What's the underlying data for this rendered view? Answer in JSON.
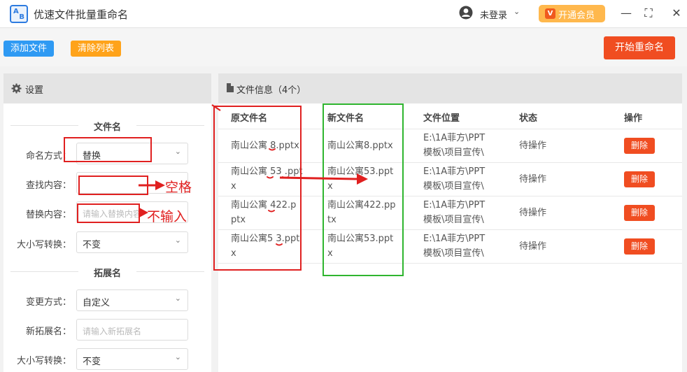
{
  "app": {
    "logo_a": "A",
    "logo_b": "B",
    "title": "优速文件批量重命名"
  },
  "header": {
    "user_label": "未登录",
    "user_caret": "⌄",
    "vip_icon": "V",
    "vip_label": "开通会员",
    "minimize": "—",
    "maximize": "⛶",
    "close": "✕"
  },
  "toolbar": {
    "add_label": "添加文件",
    "clear_label": "清除列表",
    "start_label": "开始重命名"
  },
  "settings": {
    "title": "设置",
    "filename_section": "文件名",
    "mode_label": "命名方式：",
    "mode_value": "替换",
    "find_label": "查找内容：",
    "find_value": "",
    "replace_label": "替换内容：",
    "replace_placeholder": "请输入替换内容",
    "case_label": "大小写转换：",
    "case_value": "不变",
    "ext_section": "拓展名",
    "ext_mode_label": "变更方式：",
    "ext_mode_value": "自定义",
    "new_ext_label": "新拓展名：",
    "new_ext_placeholder": "请输入新拓展名",
    "ext_case_label": "大小写转换：",
    "ext_case_value": "不变",
    "chevron": "⌄"
  },
  "files": {
    "title": "文件信息（4个）",
    "columns": [
      "原文件名",
      "新文件名",
      "文件位置",
      "状态",
      "操作"
    ],
    "rows": [
      {
        "orig_1": "南山公寓 8.pptx",
        "orig_2": "",
        "new_1": "南山公寓8.pptx",
        "new_2": "",
        "loc_1": "E:\\1A菲方\\PPT",
        "loc_2": "模板\\项目宣传\\",
        "status": "待操作",
        "action": "删除"
      },
      {
        "orig_1": "南山公寓 53 .ppt",
        "orig_2": "x",
        "new_1": "南山公寓53.ppt",
        "new_2": "x",
        "loc_1": "E:\\1A菲方\\PPT",
        "loc_2": "模板\\项目宣传\\",
        "status": "待操作",
        "action": "删除"
      },
      {
        "orig_1": "南山公寓 422.p",
        "orig_2": "ptx",
        "new_1": "南山公寓422.pp",
        "new_2": "tx",
        "loc_1": "E:\\1A菲方\\PPT",
        "loc_2": "模板\\项目宣传\\",
        "status": "待操作",
        "action": "删除"
      },
      {
        "orig_1": "南山公寓5 3.ppt",
        "orig_2": "x",
        "new_1": "南山公寓53.ppt",
        "new_2": "x",
        "loc_1": "E:\\1A菲方\\PPT",
        "loc_2": "模板\\项目宣传\\",
        "status": "待操作",
        "action": "删除"
      }
    ]
  },
  "annotations": {
    "space_note": "空格",
    "no_input_note": "不输入"
  },
  "colors": {
    "primary_blue": "#2f9af3",
    "clear_orange": "#ffa31a",
    "start_red": "#f04d21",
    "annotation_red": "#e02020",
    "annotation_green": "#2fb52f"
  }
}
